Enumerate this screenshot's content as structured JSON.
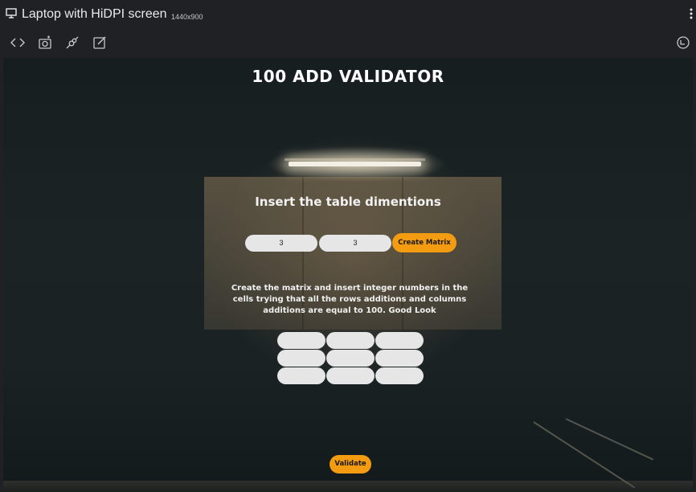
{
  "devtools": {
    "device_name": "Laptop with HiDPI screen",
    "device_resolution": "1440x900",
    "icons": [
      "monitor-icon",
      "code-icon",
      "camera-icon",
      "plug-icon",
      "edit-icon",
      "rotate-icon",
      "more-vertical-icon"
    ]
  },
  "app": {
    "title": "100 ADD VALIDATOR",
    "subtitle": "Insert the table dimentions",
    "rows_value": "3",
    "cols_value": "3",
    "create_button": "Create Matrix",
    "instructions": "Create the matrix and insert integer numbers in the cells trying that all the rows additions and columns additions are equal to 100. Good Look",
    "matrix": [
      [
        "",
        "",
        ""
      ],
      [
        "",
        "",
        ""
      ],
      [
        "",
        "",
        ""
      ]
    ],
    "validate_button": "Validate"
  },
  "colors": {
    "accent": "#f39c12",
    "input_bg": "#e6e6e6",
    "chrome_bg": "#202124"
  }
}
